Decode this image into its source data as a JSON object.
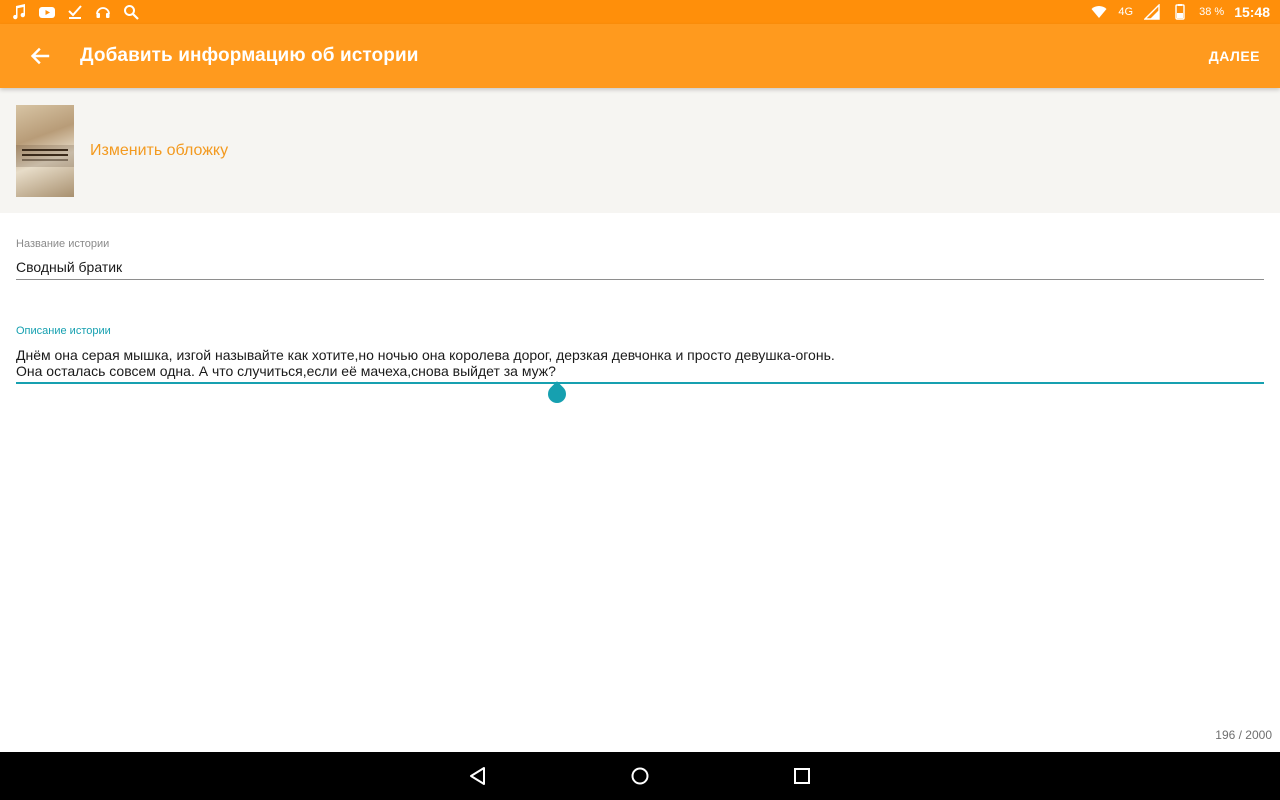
{
  "status_bar": {
    "network_label": "4G",
    "battery_percent": "38 %",
    "time": "15:48",
    "left_icons": [
      "music-icon",
      "youtube-icon",
      "checkmark-download-icon",
      "headphones-icon",
      "search-icon"
    ],
    "right_icons": [
      "wifi-icon",
      "signal-icon",
      "battery-icon"
    ]
  },
  "app_bar": {
    "title": "Добавить информацию об истории",
    "next_label": "ДАЛЕЕ",
    "background": "#ff9a1e"
  },
  "cover": {
    "change_label": "Изменить обложку",
    "cover_title_text": "Сводный братик"
  },
  "form": {
    "title_label": "Название истории",
    "title_value": "Сводный братик",
    "description_label": "Описание истории",
    "description_lines": [
      "Днём она серая мышка, изгой называйте как хотите,но ночью она королева дорог, дерзкая девчонка и просто девушка-огонь.",
      "Она осталась совсем одна. А что случиться,если её мачеха,снова выйдет за муж?"
    ],
    "char_counter": "196 / 2000"
  },
  "colors": {
    "accent": "#16a0b0",
    "brand_orange": "#ff9a1e",
    "link_orange": "#f39a20"
  },
  "nav_bar": {
    "buttons": [
      "back-triangle-icon",
      "home-circle-icon",
      "recents-square-icon"
    ]
  }
}
